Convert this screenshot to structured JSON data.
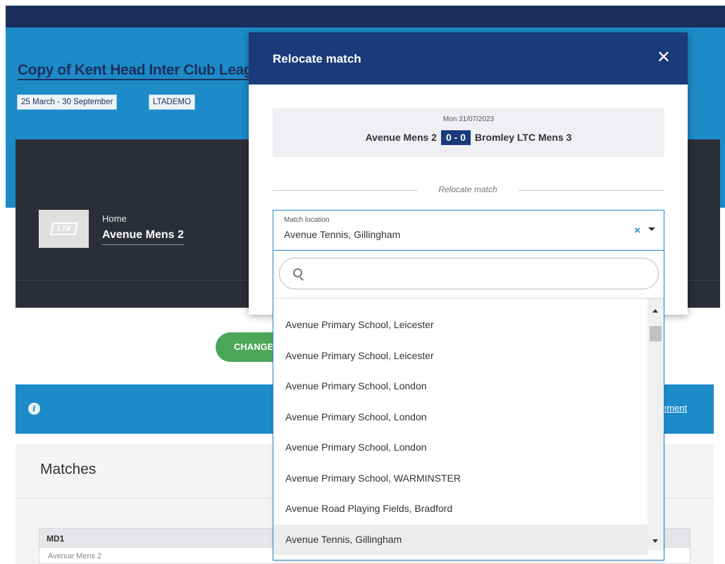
{
  "background": {
    "league_title": "Copy of Kent Head Inter Club League",
    "date_tag": "25 March - 30 September",
    "org_tag": "LTADEMO",
    "logo_text": "LTA",
    "home_label": "Home",
    "team_name": "Avenue Mens 2",
    "change_button_label": "CHANGE",
    "info_link_text": "ement",
    "matches_title": "Matches",
    "md_label": "MD1",
    "md_row_text": "Avenue Mens 2"
  },
  "modal": {
    "title": "Relocate match",
    "close_symbol": "✕",
    "match": {
      "date": "Mon 31/07/2023",
      "home_team": "Avenue Mens 2",
      "score": "0 - 0",
      "away_team": "Bromley LTC Mens 3"
    },
    "section_label": "Relocate match"
  },
  "location_select": {
    "label": "Match location",
    "value": "Avenue Tennis, Gillingham",
    "clear_symbol": "×",
    "search": {
      "value": "",
      "placeholder": ""
    },
    "options": [
      "Avenue Primary School, Leicester",
      "Avenue Primary School, Leicester",
      "Avenue Primary School, London",
      "Avenue Primary School, London",
      "Avenue Primary School, London",
      "Avenue Primary School, WARMINSTER",
      "Avenue Road Playing Fields, Bradford",
      "Avenue Tennis, Gillingham"
    ],
    "selected_index": 7
  },
  "colors": {
    "header_navy": "#1a3a7a",
    "brand_blue": "#1c8bc8",
    "dark_panel": "#2c2e37",
    "success_green": "#4ca65a",
    "focus_blue": "#2a8ac9"
  }
}
